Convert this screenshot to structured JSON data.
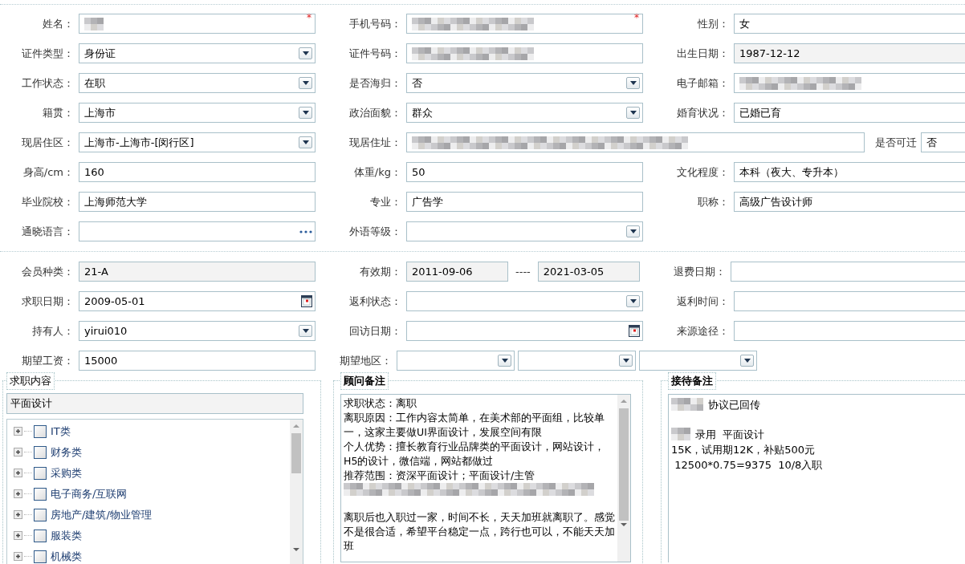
{
  "personal_rows": [
    {
      "kind": "standard",
      "fields": [
        {
          "label": "姓名：",
          "kind": "text",
          "redacted": true,
          "required_mark": "*"
        },
        {
          "label": "手机号码：",
          "kind": "text",
          "redacted": true,
          "required_mark": "*"
        },
        {
          "label": "性别：",
          "kind": "text",
          "value": "女"
        }
      ]
    },
    {
      "kind": "standard",
      "fields": [
        {
          "label": "证件类型：",
          "kind": "select",
          "value": "身份证"
        },
        {
          "label": "证件号码：",
          "kind": "text",
          "redacted": true
        },
        {
          "label": "出生日期：",
          "kind": "text",
          "value": "1987-12-12",
          "readonly": true
        }
      ]
    },
    {
      "kind": "standard",
      "fields": [
        {
          "label": "工作状态：",
          "kind": "select",
          "value": "在职"
        },
        {
          "label": "是否海归：",
          "kind": "select",
          "value": "否"
        },
        {
          "label": "电子邮箱：",
          "kind": "text",
          "redacted": true
        }
      ]
    },
    {
      "kind": "standard",
      "fields": [
        {
          "label": "籍贯：",
          "kind": "select",
          "value": "上海市"
        },
        {
          "label": "政治面貌：",
          "kind": "select",
          "value": "群众"
        },
        {
          "label": "婚育状况：",
          "kind": "text",
          "value": "已婚已育"
        }
      ]
    },
    {
      "kind": "address",
      "fields": [
        {
          "label": "现居住区：",
          "kind": "select",
          "value": "上海市-上海市-[闵行区]"
        },
        {
          "label": "现居住址：",
          "kind": "text",
          "redacted": true
        },
        {
          "label": "是否可迁",
          "kind": "text",
          "value": "否"
        }
      ]
    },
    {
      "kind": "standard",
      "fields": [
        {
          "label": "身高/cm：",
          "kind": "text",
          "value": "160"
        },
        {
          "label": "体重/kg：",
          "kind": "text",
          "value": "50"
        },
        {
          "label": "文化程度：",
          "kind": "text",
          "value": "本科（夜大、专升本）"
        }
      ]
    },
    {
      "kind": "standard",
      "fields": [
        {
          "label": "毕业院校：",
          "kind": "text",
          "value": "上海师范大学"
        },
        {
          "label": "专业：",
          "kind": "text",
          "value": "广告学"
        },
        {
          "label": "职称：",
          "kind": "text",
          "value": "高级广告设计师"
        }
      ]
    },
    {
      "kind": "standard",
      "fields": [
        {
          "label": "通晓语言：",
          "kind": "picker"
        },
        {
          "label": "外语等级：",
          "kind": "select"
        }
      ]
    }
  ],
  "membership_rows": [
    {
      "kind": "standard",
      "fields": [
        {
          "label": "会员种类：",
          "kind": "text",
          "value": "21-A",
          "readonly": true
        },
        {
          "label": "有效期：",
          "kind": "range",
          "from": {
            "value": "2011-09-06",
            "readonly": true
          },
          "separator": "----",
          "to": {
            "value": "2021-03-05",
            "readonly": true
          }
        },
        {
          "label": "退费日期：",
          "kind": "text"
        }
      ]
    },
    {
      "kind": "standard",
      "fields": [
        {
          "label": "求职日期：",
          "kind": "date",
          "value": "2009-05-01"
        },
        {
          "label": "返利状态：",
          "kind": "select"
        },
        {
          "label": "返利时间：",
          "kind": "text"
        }
      ]
    },
    {
      "kind": "standard",
      "fields": [
        {
          "label": "持有人：",
          "kind": "select",
          "value": "yirui010"
        },
        {
          "label": "回访日期：",
          "kind": "date"
        },
        {
          "label": "来源途径：",
          "kind": "text"
        }
      ]
    },
    {
      "kind": "standard",
      "fields": [
        {
          "label": "期望工资：",
          "kind": "text",
          "value": "15000"
        },
        {
          "label": "期望地区：",
          "kind": "region",
          "selects": [
            {
              "kind": "select"
            },
            {
              "kind": "select"
            },
            {
              "kind": "select"
            }
          ]
        }
      ]
    }
  ],
  "job_panel": {
    "title": "求职内容",
    "selected_value": "平面设计",
    "tree": [
      {
        "label": "IT类",
        "expanded": false,
        "checked": false
      },
      {
        "label": "财务类",
        "expanded": false,
        "checked": false
      },
      {
        "label": "采购类",
        "expanded": false,
        "checked": false
      },
      {
        "label": "电子商务/互联网",
        "expanded": false,
        "checked": false
      },
      {
        "label": "房地产/建筑/物业管理",
        "expanded": false,
        "checked": false
      },
      {
        "label": "服装类",
        "expanded": false,
        "checked": false
      },
      {
        "label": "机械类",
        "expanded": false,
        "checked": false
      }
    ]
  },
  "advisor_panel": {
    "title": "顾问备注",
    "lines": [
      {
        "text": "求职状态：离职"
      },
      {
        "text": "离职原因：工作内容太简单，在美术部的平面组，比较单一，这家主要做UI界面设计，发展空间有限"
      },
      {
        "text": "个人优势：擅长教育行业品牌类的平面设计，网站设计，H5的设计，微信端，网站都做过"
      },
      {
        "text": "推荐范围：资深平面设计；平面设计/主管"
      },
      {
        "redacted": true
      },
      {
        "kind": "blank"
      },
      {
        "text": "离职后也入职过一家，时间不长，天天加班就离职了。感觉不是很合适，希望平台稳定一点，跨行也可以，不能天天加班"
      }
    ]
  },
  "reception_panel": {
    "title": "接待备注",
    "lines": [
      {
        "redacted": true,
        "text": "协议已回传"
      },
      {
        "kind": "blank"
      },
      {
        "redacted": true,
        "text": "录用  平面设计"
      },
      {
        "text": "15K，试用期12K，补贴500元"
      },
      {
        "text": " 12500*0.75=9375  10/8入职"
      }
    ]
  }
}
